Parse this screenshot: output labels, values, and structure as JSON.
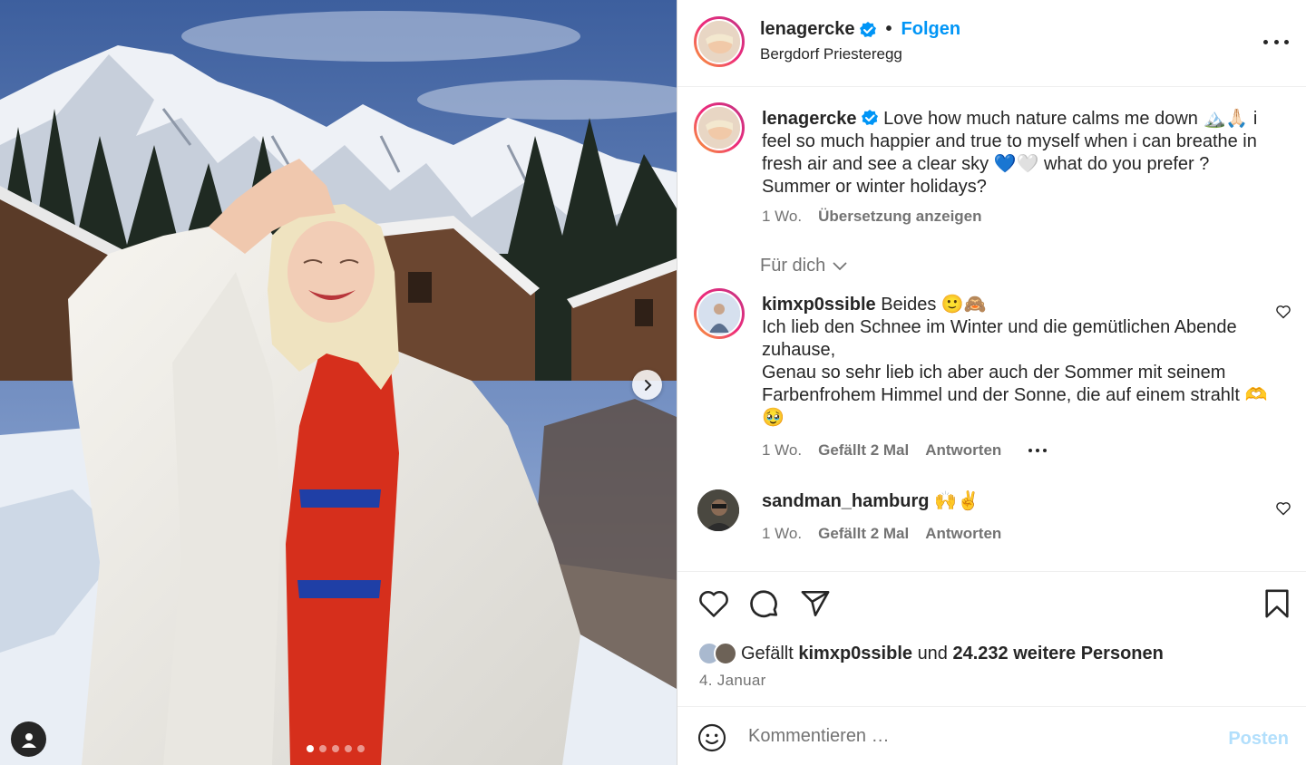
{
  "post": {
    "author": "lenagercke",
    "location": "Bergdorf Priesteregg",
    "follow_label": "Folgen",
    "header_separator": "•",
    "caption_text": "Love how much nature calms me down 🏔️🙏🏻 i feel so much happier and true to myself when i can breathe in fresh air and see a clear sky 💙🤍 what do you prefer ? Summer or winter holidays?",
    "caption_time": "1 Wo.",
    "translate_label": "Übersetzung anzeigen"
  },
  "comments_filter": "Für dich",
  "comments": [
    {
      "user": "kimxp0ssible",
      "text": "Beides 🙂🙈",
      "text_rest": "Ich lieb den Schnee im Winter und die gemütlichen Abende zuhause,",
      "text_rest2": "Genau so sehr lieb ich aber auch der Sommer mit seinem Farbenfrohem Himmel und der Sonne, die auf einem strahlt 🫶🥹",
      "time": "1 Wo.",
      "likes": "Gefällt 2 Mal",
      "reply": "Antworten"
    },
    {
      "user": "sandman_hamburg",
      "text": "🙌✌️",
      "time": "1 Wo.",
      "likes": "Gefällt 2 Mal",
      "reply": "Antworten"
    }
  ],
  "likes_summary": {
    "prefix": "Gefällt",
    "user": "kimxp0ssible",
    "connector": "und",
    "count_text": "24.232 weitere Personen"
  },
  "post_date": "4. Januar",
  "comment_box": {
    "placeholder": "Kommentieren …",
    "post_label": "Posten"
  },
  "carousel": {
    "slides": 5,
    "active": 1
  },
  "icons": [
    "verified-icon",
    "more-icon",
    "chevron-down-icon",
    "heart-icon",
    "comment-icon",
    "share-icon",
    "bookmark-icon",
    "emoji-icon",
    "next-arrow-icon",
    "tag-person-icon"
  ],
  "colors": {
    "accent": "#0095f6",
    "post_disabled": "#b2dffc",
    "secondary_text": "#737373"
  }
}
